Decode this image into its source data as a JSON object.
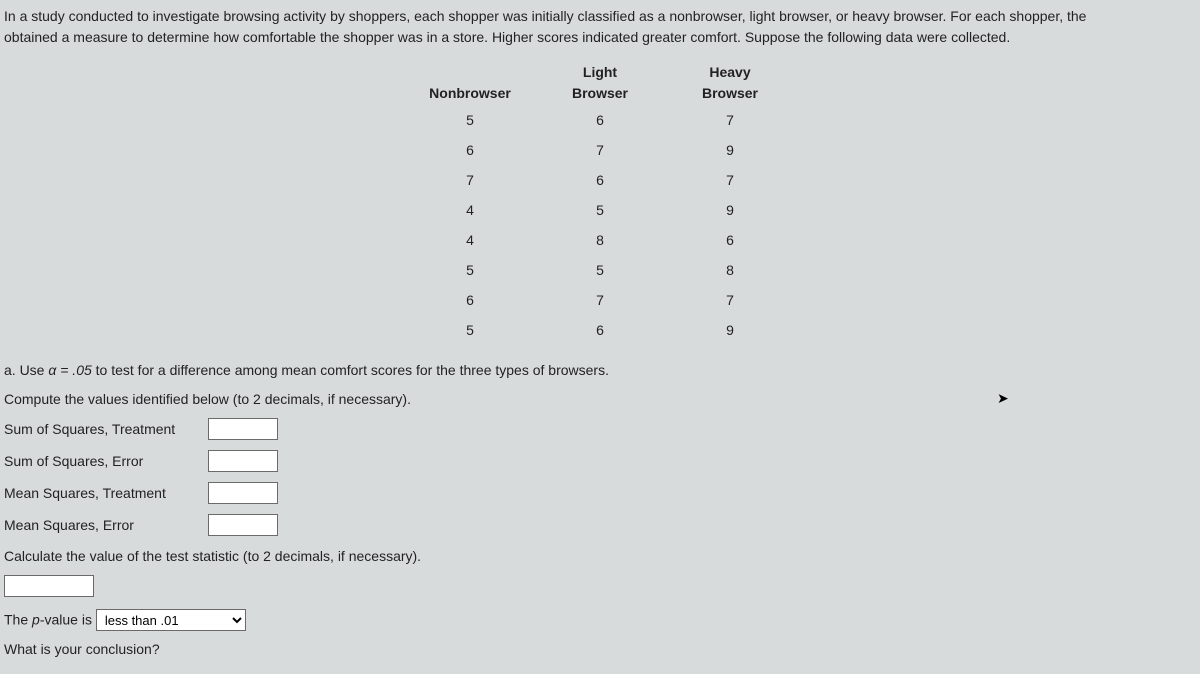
{
  "intro": {
    "line1": "In a study conducted to investigate browsing activity by shoppers, each shopper was initially classified as a nonbrowser, light browser, or heavy browser. For each shopper, the",
    "line2": "obtained a measure to determine how comfortable the shopper was in a store. Higher scores indicated greater comfort. Suppose the following data were collected."
  },
  "table": {
    "headers": [
      "Nonbrowser",
      "Light\nBrowser",
      "Heavy\nBrowser"
    ],
    "rows": [
      [
        "5",
        "6",
        "7"
      ],
      [
        "6",
        "7",
        "9"
      ],
      [
        "7",
        "6",
        "7"
      ],
      [
        "4",
        "5",
        "9"
      ],
      [
        "4",
        "8",
        "6"
      ],
      [
        "5",
        "5",
        "8"
      ],
      [
        "6",
        "7",
        "7"
      ],
      [
        "5",
        "6",
        "9"
      ]
    ]
  },
  "partA": {
    "prefix": "a. Use ",
    "alpha": "α = .05",
    "suffix": " to test for a difference among mean comfort scores for the three types of browsers.",
    "compute": "Compute the values identified below (to 2 decimals, if necessary)."
  },
  "labels": {
    "sst": "Sum of Squares, Treatment",
    "sse": "Sum of Squares, Error",
    "mst": "Mean Squares, Treatment",
    "mse": "Mean Squares, Error"
  },
  "calcStat": "Calculate the value of the test statistic (to 2 decimals, if necessary).",
  "pvalue": {
    "prefix": "The ",
    "pLabel": "p",
    "suffix": "-value is",
    "selected": "less than .01"
  },
  "conclusion": "What is your conclusion?"
}
